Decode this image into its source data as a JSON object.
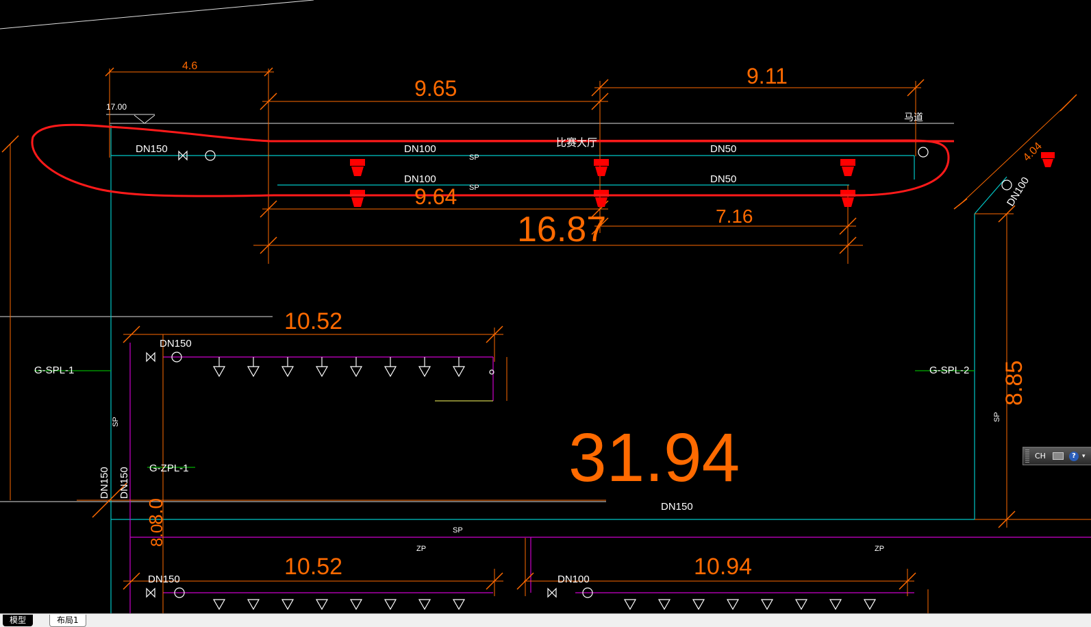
{
  "drawing": {
    "elevation": "17.00",
    "room_name": "比赛大厅",
    "catwalk": "马道",
    "pipe_dn150": "DN150",
    "pipe_dn100": "DN100",
    "pipe_dn50": "DN50",
    "line_sp": "SP",
    "line_zp": "ZP",
    "valve_l": "L",
    "riser_g_spl_1": "G-SPL-1",
    "riser_g_spl_2": "G-SPL-2",
    "riser_g_zpl_1": "G-ZPL-1",
    "dims": {
      "d_4_6": "4.6",
      "d_9_65": "9.65",
      "d_9_11": "9.11",
      "d_9_64": "9.64",
      "d_16_87": "16.87",
      "d_7_16": "7.16",
      "d_10_52_top": "10.52",
      "d_10_52_bottom": "10.52",
      "d_10_94": "10.94",
      "d_31_94": "31.94",
      "d_8_85": "8.85",
      "d_4_04": "4.04",
      "d_8_0": "8.0",
      "d_8_0_low": "8.0"
    },
    "colors": {
      "dimension": "#ff6a00",
      "pipe": "#00c8c8",
      "zp_pipe": "#cc00cc",
      "markup": "#ff0000",
      "label_green": "#00b000",
      "background": "#000000"
    }
  },
  "tabs": {
    "model": "模型",
    "layout1": "布局1"
  },
  "ime": {
    "lang": "CH",
    "help": "?"
  }
}
